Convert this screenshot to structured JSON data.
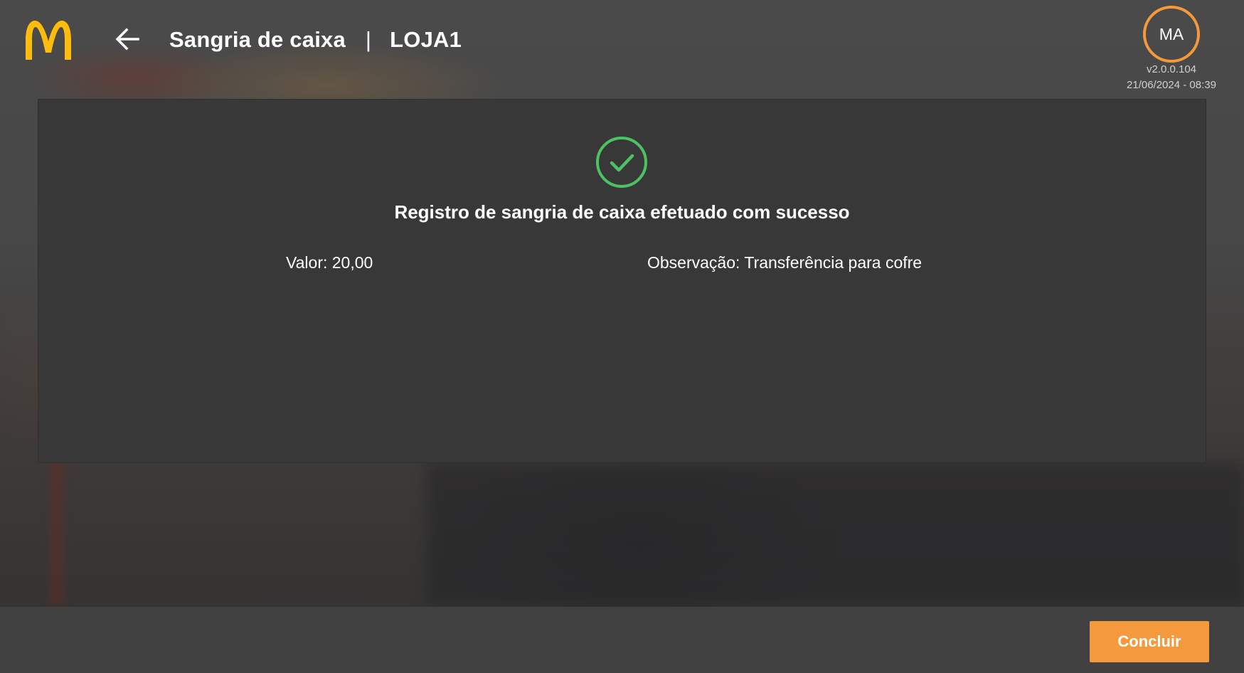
{
  "header": {
    "title": "Sangria de caixa",
    "separator": "|",
    "store": "LOJA1",
    "back_icon": "arrow-left-icon",
    "logo": "mcdonalds-arches-logo"
  },
  "user": {
    "initials": "MA",
    "version": "v2.0.0.104",
    "datetime": "21/06/2024 - 08:39"
  },
  "result": {
    "status_icon": "check-circle-icon",
    "message": "Registro de sangria de caixa efetuado com sucesso",
    "valor": "Valor: 20,00",
    "observacao": "Observação: Transferência para cofre"
  },
  "footer": {
    "concluir_label": "Concluir"
  },
  "colors": {
    "accent": "#f49a3c",
    "success": "#4cc262",
    "logo_yellow": "#ffbc0d",
    "card_bg": "#383838",
    "footer_bg": "#414141"
  }
}
